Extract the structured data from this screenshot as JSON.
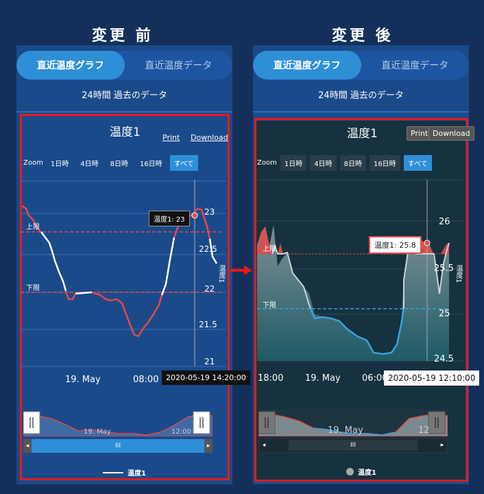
{
  "before": {
    "heading": "変更 前",
    "tabs": [
      "直近温度グラフ",
      "直近温度データ"
    ],
    "subtitle": "24時間 過去のデータ",
    "chart_title": "温度1",
    "print": "Print",
    "download": "Download",
    "zoom_label": "Zoom",
    "zoom_buttons": [
      "1日時",
      "4日時",
      "8日時",
      "16日時",
      "すべて"
    ],
    "upper_limit": "上限",
    "lower_limit": "下限",
    "y_ticks": [
      "23",
      "22.5",
      "22",
      "21.5",
      "21"
    ],
    "x_ticks": [
      "19. May",
      "08:00"
    ],
    "tooltip": "温度1: 23",
    "time_label": "2020-05-19 14:20:00",
    "y_title": "温度1",
    "nav_labels": [
      "19. May",
      "12:00"
    ],
    "scroll_mid": "III",
    "legend": "温度1"
  },
  "after": {
    "heading": "変更 後",
    "tabs": [
      "直近温度グラフ",
      "直近温度データ"
    ],
    "subtitle": "24時間 過去のデータ",
    "chart_title": "温度1",
    "print": "Print",
    "download": "Download",
    "zoom_label": "Zoom",
    "zoom_buttons": [
      "1日時",
      "4日時",
      "8日時",
      "16日時",
      "すべて"
    ],
    "upper_limit": "上限",
    "lower_limit": "下限",
    "y_ticks": [
      "26",
      "25.5",
      "25",
      "24.5"
    ],
    "x_ticks": [
      "18:00",
      "19. May",
      "06:00"
    ],
    "tooltip": "温度1: 25.8",
    "time_label": "2020-05-19 12:10:00",
    "y_title": "温度1",
    "nav_labels": [
      "19. May",
      "12"
    ],
    "scroll_mid": "III",
    "legend": "温度1"
  },
  "colors": {
    "page_bg": "#14305a",
    "panel_bg": "#1b4a8a",
    "after_chart_bg": "#16313f",
    "highlight_border": "#e81a1a",
    "tab_active": "#2f8fd6",
    "line_above": "#e24a4a",
    "line_normal_before": "#ffffff",
    "line_normal_after": "#3aa0e0"
  }
}
